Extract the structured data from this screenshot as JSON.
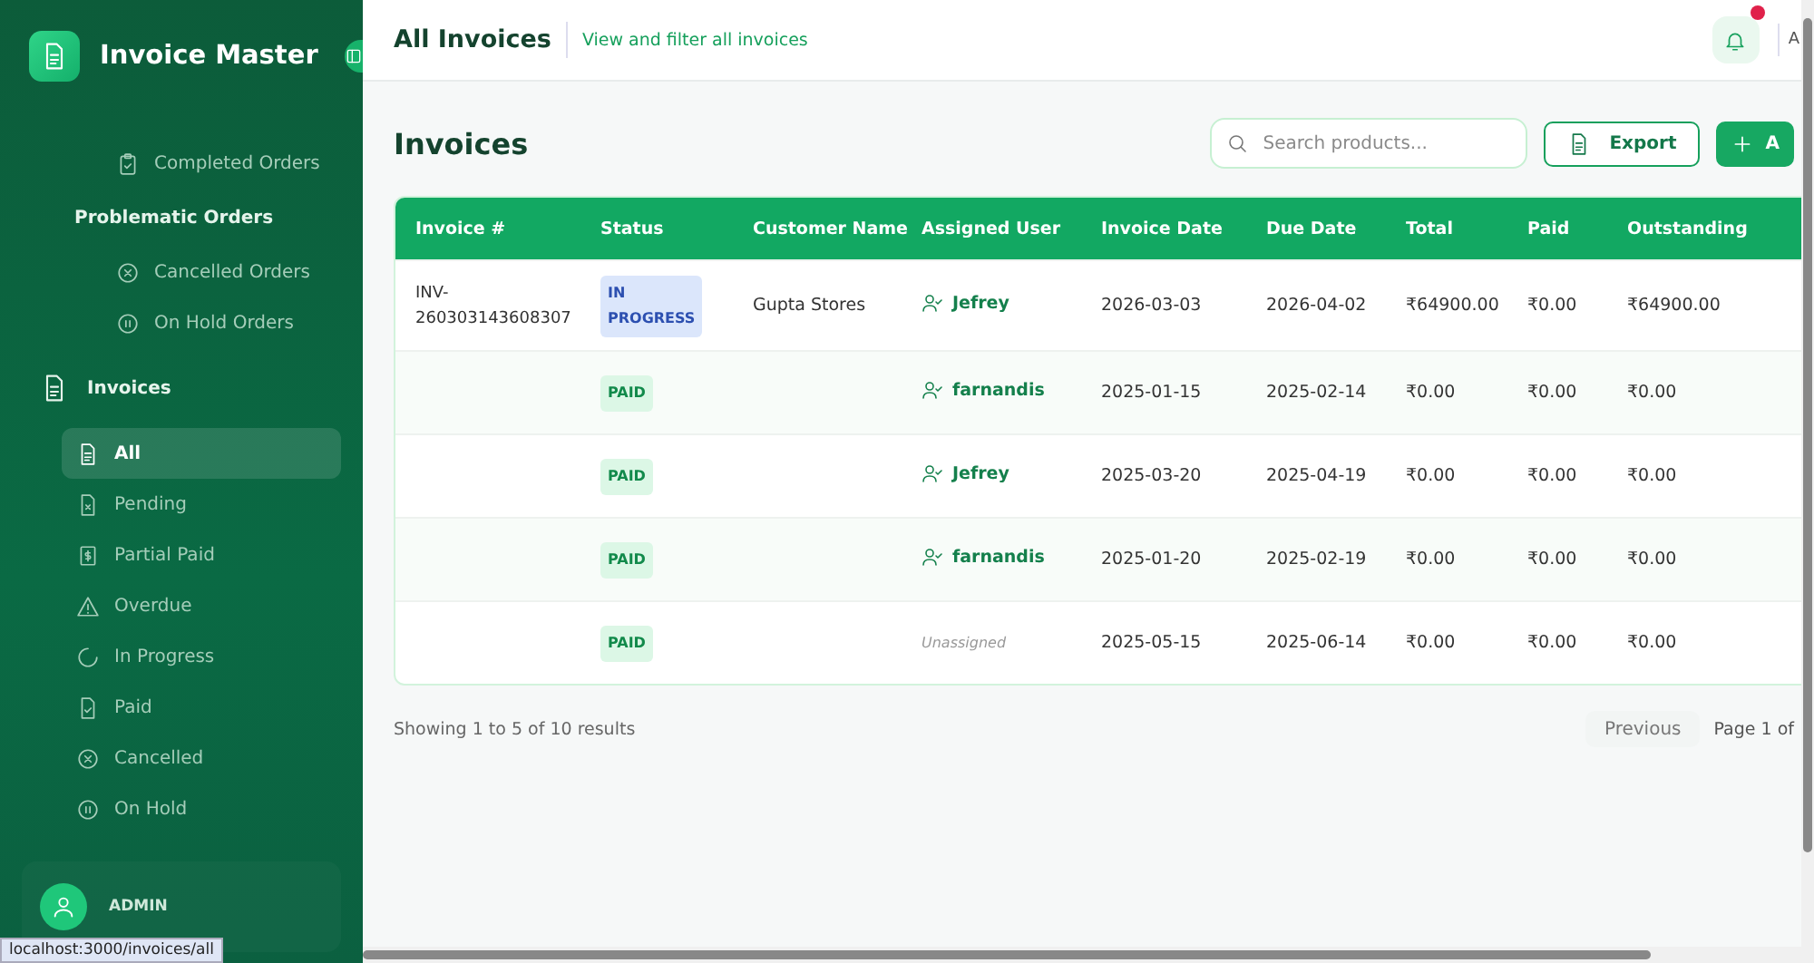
{
  "app": {
    "name": "Invoice Master"
  },
  "sidebar": {
    "items": [
      {
        "label": "Completed Orders",
        "kind": "sub",
        "selected": false
      },
      {
        "label": "Problematic Orders",
        "kind": "heading",
        "selected": false
      },
      {
        "label": "Cancelled Orders",
        "kind": "sub",
        "selected": false
      },
      {
        "label": "On Hold Orders",
        "kind": "sub",
        "selected": false
      },
      {
        "label": "Invoices",
        "kind": "section",
        "selected": false
      },
      {
        "label": "All",
        "kind": "child",
        "selected": true
      },
      {
        "label": "Pending",
        "kind": "child",
        "selected": false
      },
      {
        "label": "Partial Paid",
        "kind": "child",
        "selected": false
      },
      {
        "label": "Overdue",
        "kind": "child",
        "selected": false
      },
      {
        "label": "In Progress",
        "kind": "child",
        "selected": false
      },
      {
        "label": "Paid",
        "kind": "child",
        "selected": false
      },
      {
        "label": "Cancelled",
        "kind": "child",
        "selected": false
      },
      {
        "label": "On Hold",
        "kind": "child",
        "selected": false
      }
    ],
    "user": "ADMIN"
  },
  "header": {
    "title": "All Invoices",
    "subtitle": "View and filter all invoices",
    "notification": true,
    "user_initial": "A"
  },
  "page": {
    "title": "Invoices",
    "search": {
      "placeholder": "Search products..."
    },
    "buttons": [
      {
        "label": "Export",
        "kind": "outline"
      },
      {
        "label": "A",
        "kind": "add"
      }
    ]
  },
  "table": {
    "columns": [
      "Invoice #",
      "Status",
      "Customer Name",
      "Assigned User",
      "Invoice Date",
      "Due Date",
      "Total",
      "Paid",
      "Outstanding"
    ],
    "rows": [
      {
        "invoice": "INV-260303143608307",
        "status": "IN PROGRESS",
        "kind": "progress",
        "customer": "Gupta Stores",
        "user": "Jefrey",
        "assigned": true,
        "invoice_date": "2026-03-03",
        "due_date": "2026-04-02",
        "total": "₹64900.00",
        "paid": "₹0.00",
        "outstanding": "₹64900.00"
      },
      {
        "status": "PAID",
        "kind": "paid",
        "user": "farnandis",
        "assigned": true,
        "invoice_date": "2025-01-15",
        "due_date": "2025-02-14",
        "total": "₹0.00",
        "paid": "₹0.00",
        "outstanding": "₹0.00"
      },
      {
        "status": "PAID",
        "kind": "paid",
        "user": "Jefrey",
        "assigned": true,
        "invoice_date": "2025-03-20",
        "due_date": "2025-04-19",
        "total": "₹0.00",
        "paid": "₹0.00",
        "outstanding": "₹0.00"
      },
      {
        "status": "PAID",
        "kind": "paid",
        "user": "farnandis",
        "assigned": true,
        "invoice_date": "2025-01-20",
        "due_date": "2025-02-19",
        "total": "₹0.00",
        "paid": "₹0.00",
        "outstanding": "₹0.00"
      },
      {
        "status": "PAID",
        "kind": "paid",
        "user": "Unassigned",
        "assigned": false,
        "invoice_date": "2025-05-15",
        "due_date": "2025-06-14",
        "total": "₹0.00",
        "paid": "₹0.00",
        "outstanding": "₹0.00"
      }
    ]
  },
  "pagination": {
    "summary": "Showing 1 to 5 of 10 results",
    "previous": "Previous",
    "page": "Page 1 of"
  },
  "status_bar": {
    "url": "localhost:3000/invoices/all"
  }
}
